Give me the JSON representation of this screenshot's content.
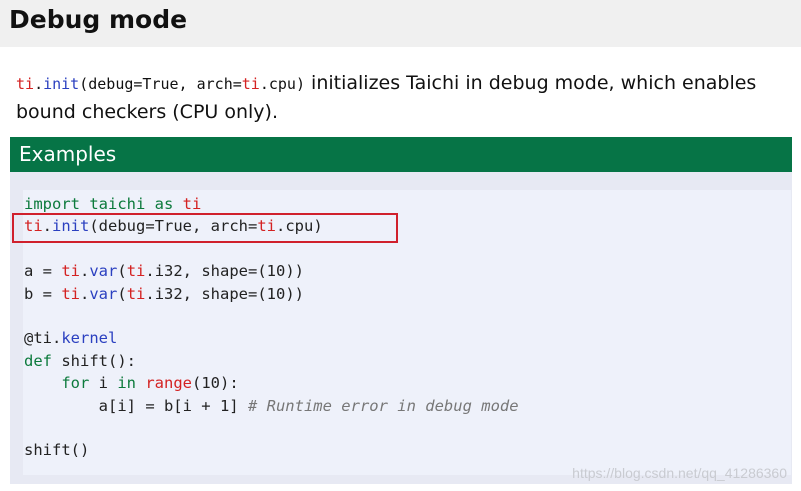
{
  "header": {
    "title": "Debug mode"
  },
  "intro": {
    "code_mod": "ti",
    "code_dot": ".",
    "code_fn": "init",
    "code_args_a": "(debug=True, arch=",
    "code_args_mod": "ti",
    "code_args_b": ".cpu)",
    "text": " initializes Taichi in debug mode, which enables bound checkers (CPU only)."
  },
  "examples": {
    "title": "Examples",
    "code": {
      "l1_a": "import taichi as ",
      "l1_b": "ti",
      "l2_mod": "ti",
      "l2_dot": ".",
      "l2_fn": "init",
      "l2_rest_a": "(debug=True, arch=",
      "l2_mod2": "ti",
      "l2_rest_b": ".cpu)",
      "l4_a": "a = ",
      "l4_mod": "ti",
      "l4_dot": ".",
      "l4_fn": "var",
      "l4_paren": "(",
      "l4_mod2": "ti",
      "l4_rest": ".i32, shape=(10))",
      "l5_a": "b = ",
      "l5_mod": "ti",
      "l5_dot": ".",
      "l5_fn": "var",
      "l5_paren": "(",
      "l5_mod2": "ti",
      "l5_rest": ".i32, shape=(10))",
      "l7_a": "@ti.",
      "l7_b": "kernel",
      "l8_a": "def",
      "l8_b": " shift():",
      "l9_indent": "    ",
      "l9_a": "for",
      "l9_b": " i ",
      "l9_c": "in",
      "l9_d": " ",
      "l9_e": "range",
      "l9_f": "(10):",
      "l10_a": "        a[i] = b[i + 1] ",
      "l10_comment": "# Runtime error in debug mode",
      "l12": "shift()"
    }
  },
  "watermark": "https://blog.csdn.net/qq_41286360",
  "colors": {
    "examples_bar": "#067446",
    "highlight_border": "#d0202c",
    "code_background": "#eef1fa"
  }
}
